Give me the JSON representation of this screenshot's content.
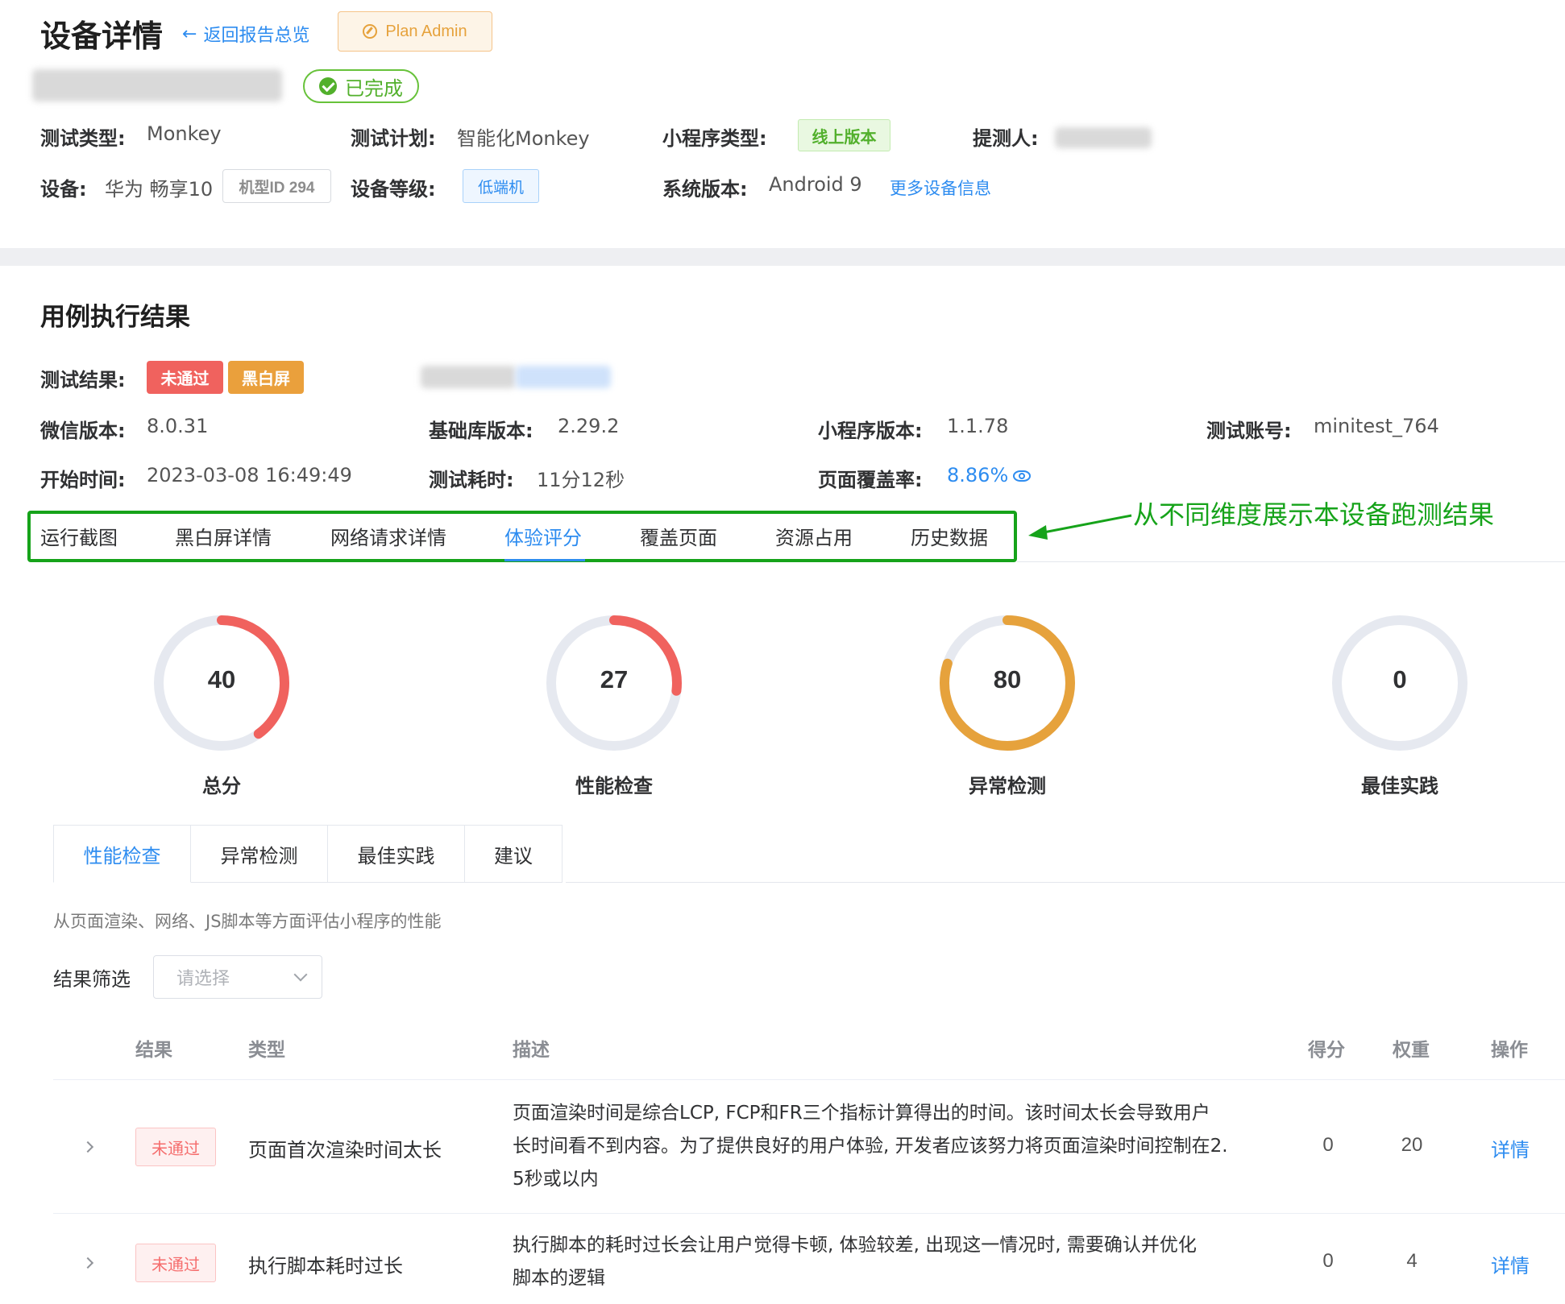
{
  "header": {
    "title": "设备详情",
    "back_label": "返回报告总览",
    "plan_admin_label": "Plan Admin",
    "status_label": "已完成"
  },
  "info": {
    "test_type_label": "测试类型:",
    "test_type_value": "Monkey",
    "test_plan_label": "测试计划:",
    "test_plan_value": "智能化Monkey",
    "mp_type_label": "小程序类型:",
    "mp_type_value": "线上版本",
    "submitter_label": "提测人:",
    "device_label": "设备:",
    "device_value": "华为 畅享10",
    "model_id": "机型ID 294",
    "device_level_label": "设备等级:",
    "device_level_value": "低端机",
    "os_label": "系统版本:",
    "os_value": "Android 9",
    "more_info": "更多设备信息"
  },
  "result": {
    "section_title": "用例执行结果",
    "result_label": "测试结果:",
    "badge_fail": "未通过",
    "badge_blackwhite": "黑白屏",
    "wechat_label": "微信版本:",
    "wechat_value": "8.0.31",
    "baselib_label": "基础库版本:",
    "baselib_value": "2.29.2",
    "mp_version_label": "小程序版本:",
    "mp_version_value": "1.1.78",
    "account_label": "测试账号:",
    "account_value": "minitest_764",
    "start_label": "开始时间:",
    "start_value": "2023-03-08 16:49:49",
    "duration_label": "测试耗时:",
    "duration_value": "11分12秒",
    "coverage_label": "页面覆盖率:",
    "coverage_value": "8.86%"
  },
  "tabs": [
    "运行截图",
    "黑白屏详情",
    "网络请求详情",
    "体验评分",
    "覆盖页面",
    "资源占用",
    "历史数据"
  ],
  "active_tab": "体验评分",
  "annotation": "从不同维度展示本设备跑测结果",
  "scores": [
    {
      "label": "总分",
      "value": 40,
      "color": "#f0625e"
    },
    {
      "label": "性能检查",
      "value": 27,
      "color": "#f0625e"
    },
    {
      "label": "异常检测",
      "value": 80,
      "color": "#e6a23c"
    },
    {
      "label": "最佳实践",
      "value": 0,
      "color": "#e6a23c"
    }
  ],
  "subtabs": [
    "性能检查",
    "异常检测",
    "最佳实践",
    "建议"
  ],
  "subtab_desc": "从页面渲染、网络、JS脚本等方面评估小程序的性能",
  "filter": {
    "label": "结果筛选",
    "placeholder": "请选择"
  },
  "table": {
    "headers": [
      "结果",
      "类型",
      "描述",
      "得分",
      "权重",
      "操作"
    ],
    "rows": [
      {
        "result": "未通过",
        "type": "页面首次渲染时间太长",
        "desc_lines": [
          "页面渲染时间是综合LCP, FCP和FR三个指标计算得出的时间。该时间太长会导致用户",
          "长时间看不到内容。为了提供良好的用户体验, 开发者应该努力将页面渲染时间控制在2.",
          "5秒或以内"
        ],
        "score": "0",
        "weight": "20",
        "action": "详情"
      },
      {
        "result": "未通过",
        "type": "执行脚本耗时过长",
        "desc_lines": [
          "执行脚本的耗时过长会让用户觉得卡顿, 体验较差, 出现这一情况时, 需要确认并优化",
          "脚本的逻辑"
        ],
        "score": "0",
        "weight": "4",
        "action": "详情"
      }
    ]
  }
}
